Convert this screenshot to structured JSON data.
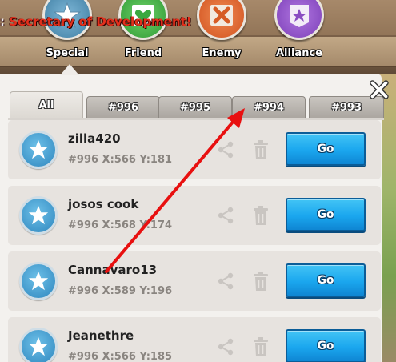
{
  "header": {
    "ticker_prefix": ":",
    "ticker_text": "Secretary of Development!"
  },
  "categories": [
    {
      "label": "Special",
      "icon": "star-icon"
    },
    {
      "label": "Friend",
      "icon": "heart-icon"
    },
    {
      "label": "Enemy",
      "icon": "crossed-swords-icon"
    },
    {
      "label": "Alliance",
      "icon": "star-banner-icon"
    }
  ],
  "tabs": [
    {
      "label": "All",
      "active": true
    },
    {
      "label": "#996"
    },
    {
      "label": "#995"
    },
    {
      "label": "#994"
    },
    {
      "label": "#993"
    }
  ],
  "bookmarks": [
    {
      "name": "zilla420",
      "coords": "#996 X:566 Y:181",
      "go_label": "Go"
    },
    {
      "name": "josos cook",
      "coords": "#996 X:568 Y:174",
      "go_label": "Go"
    },
    {
      "name": "Cannavaro13",
      "coords": "#996 X:589 Y:196",
      "go_label": "Go"
    },
    {
      "name": "Jeanethre",
      "coords": "#996 X:566 Y:185",
      "go_label": "Go"
    }
  ],
  "colors": {
    "go_button": "#1aa6ee",
    "annotation_arrow": "#e81010",
    "ticker_text": "#e3301c"
  }
}
